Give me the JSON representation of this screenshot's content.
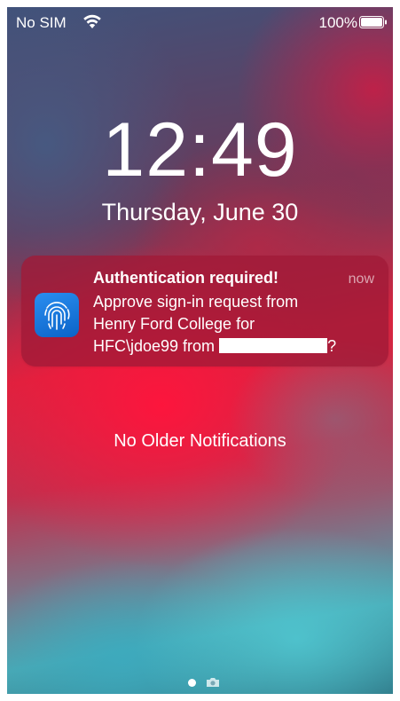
{
  "status_bar": {
    "carrier": "No SIM",
    "battery_percent": "100%",
    "wifi_icon": "wifi-icon",
    "battery_icon": "battery-full-icon"
  },
  "lock_screen": {
    "time": "12:49",
    "date": "Thursday, June 30"
  },
  "notification": {
    "app_icon": "fingerprint-icon",
    "title": "Authentication required!",
    "time": "now",
    "body_line1": "Approve sign-in request from",
    "body_line2": "Henry Ford College for",
    "body_line3_prefix": "HFC\\jdoe99 from ",
    "body_line3_suffix": "?"
  },
  "no_older_notifications": "No Older Notifications",
  "page_indicator": {
    "camera_icon": "camera-icon"
  },
  "colors": {
    "notification_bg": "#a01937",
    "app_icon": "#1a7be0",
    "text": "#ffffff"
  }
}
